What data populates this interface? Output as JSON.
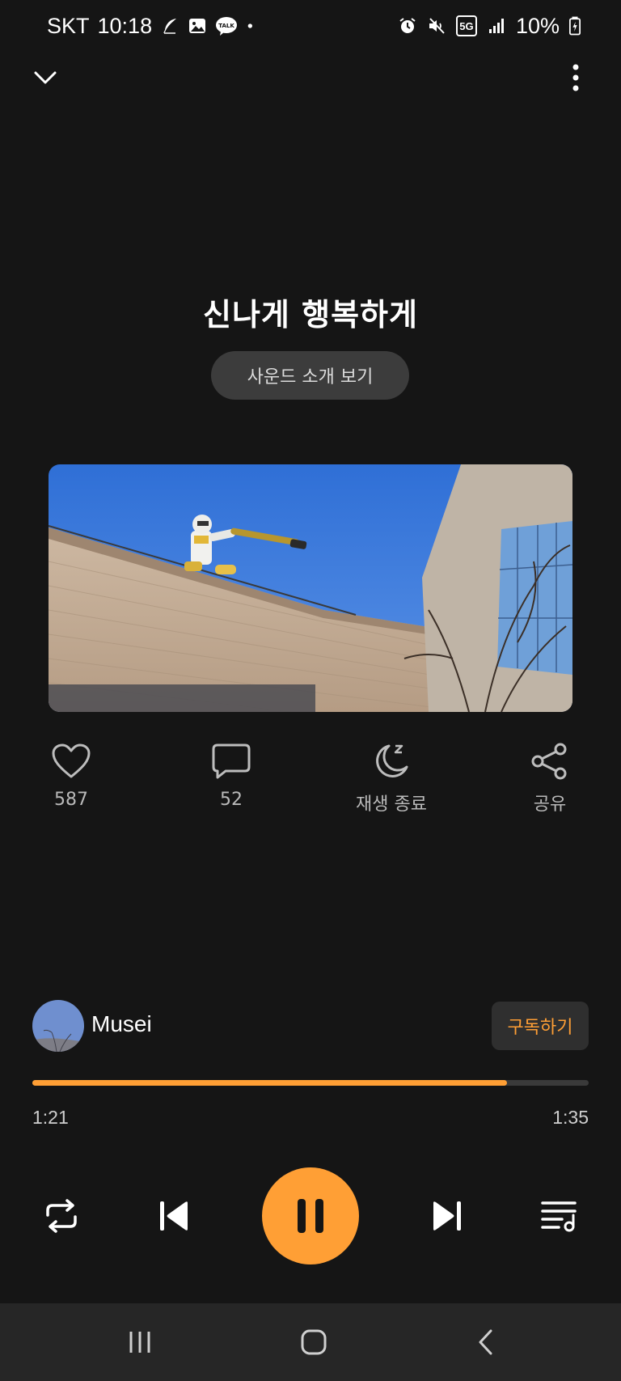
{
  "status_bar": {
    "carrier": "SKT",
    "time": "10:18",
    "network": "5G",
    "battery": "10%"
  },
  "player": {
    "title": "신나게 행복하게",
    "intro_button": "사운드 소개 보기"
  },
  "actions": {
    "like_count": "587",
    "comment_count": "52",
    "sleep_label": "재생 종료",
    "share_label": "공유"
  },
  "artist": {
    "name": "Musei",
    "subscribe_label": "구독하기"
  },
  "progress": {
    "elapsed": "1:21",
    "total": "1:35",
    "fraction": 0.853
  },
  "colors": {
    "accent": "#ff9f35",
    "background": "#151515",
    "nav_bar": "#262626"
  }
}
